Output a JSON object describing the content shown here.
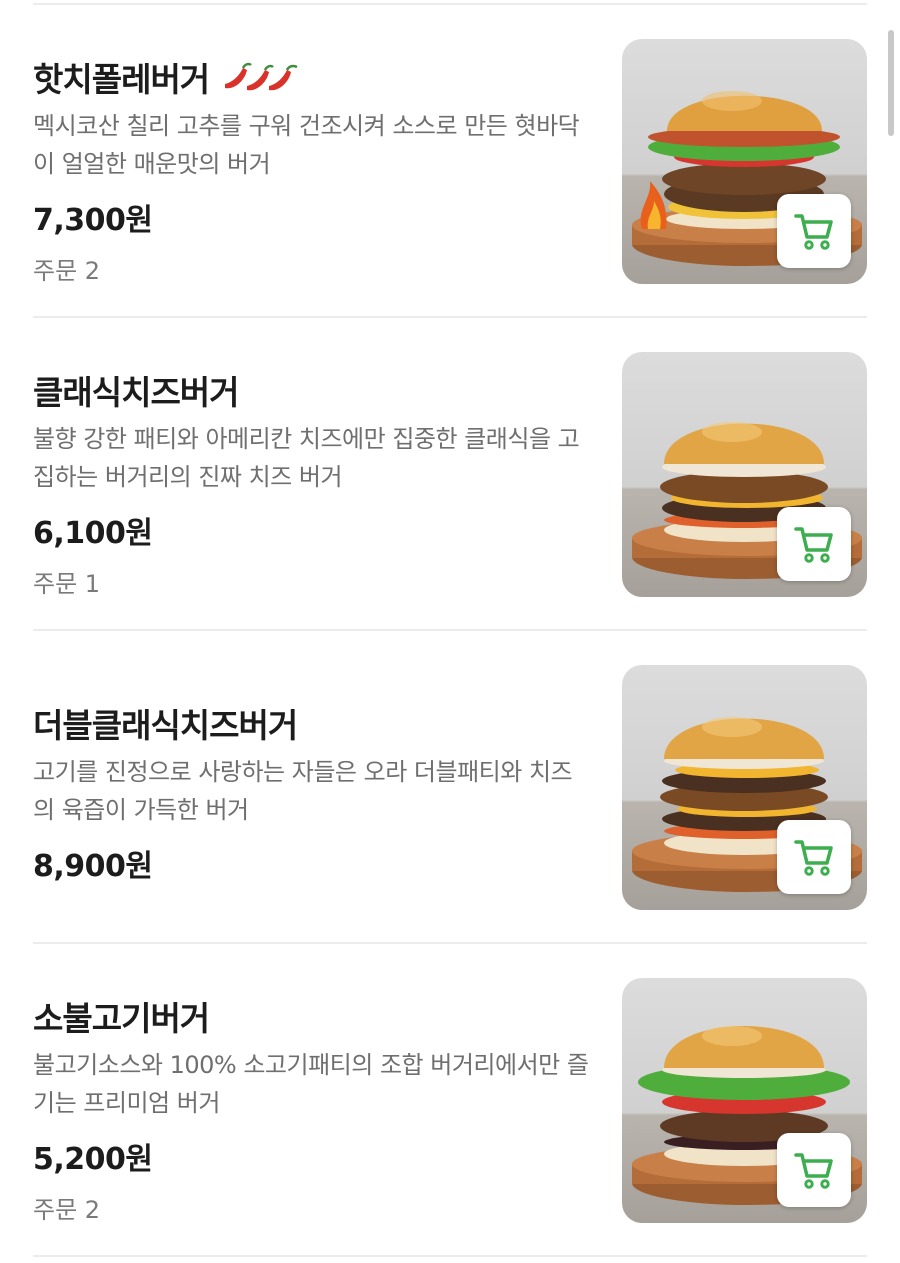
{
  "accent_color": "#3dae4f",
  "items": [
    {
      "name": "핫치폴레버거",
      "spicy": true,
      "description": "멕시코산 칠리 고추를 구워 건조시켜 소스로 만든 혓바닥이 얼얼한 매운맛의 버거",
      "price": "7,300원",
      "orders": "주문 2",
      "image_icon": "burger-image",
      "cart_icon": "cart-icon"
    },
    {
      "name": "클래식치즈버거",
      "spicy": false,
      "description": "불향 강한 패티와 아메리칸 치즈에만 집중한 클래식을 고집하는 버거리의 진짜 치즈 버거",
      "price": "6,100원",
      "orders": "주문 1",
      "image_icon": "burger-image",
      "cart_icon": "cart-icon"
    },
    {
      "name": "더블클래식치즈버거",
      "spicy": false,
      "description": "고기를 진정으로 사랑하는 자들은 오라 더블패티와 치즈의 육즙이 가득한 버거",
      "price": "8,900원",
      "orders": "",
      "image_icon": "burger-image",
      "cart_icon": "cart-icon"
    },
    {
      "name": "소불고기버거",
      "spicy": false,
      "description": "불고기소스와 100% 소고기패티의 조합 버거리에서만 즐기는 프리미엄 버거",
      "price": "5,200원",
      "orders": "주문 2",
      "image_icon": "burger-image",
      "cart_icon": "cart-icon"
    }
  ]
}
